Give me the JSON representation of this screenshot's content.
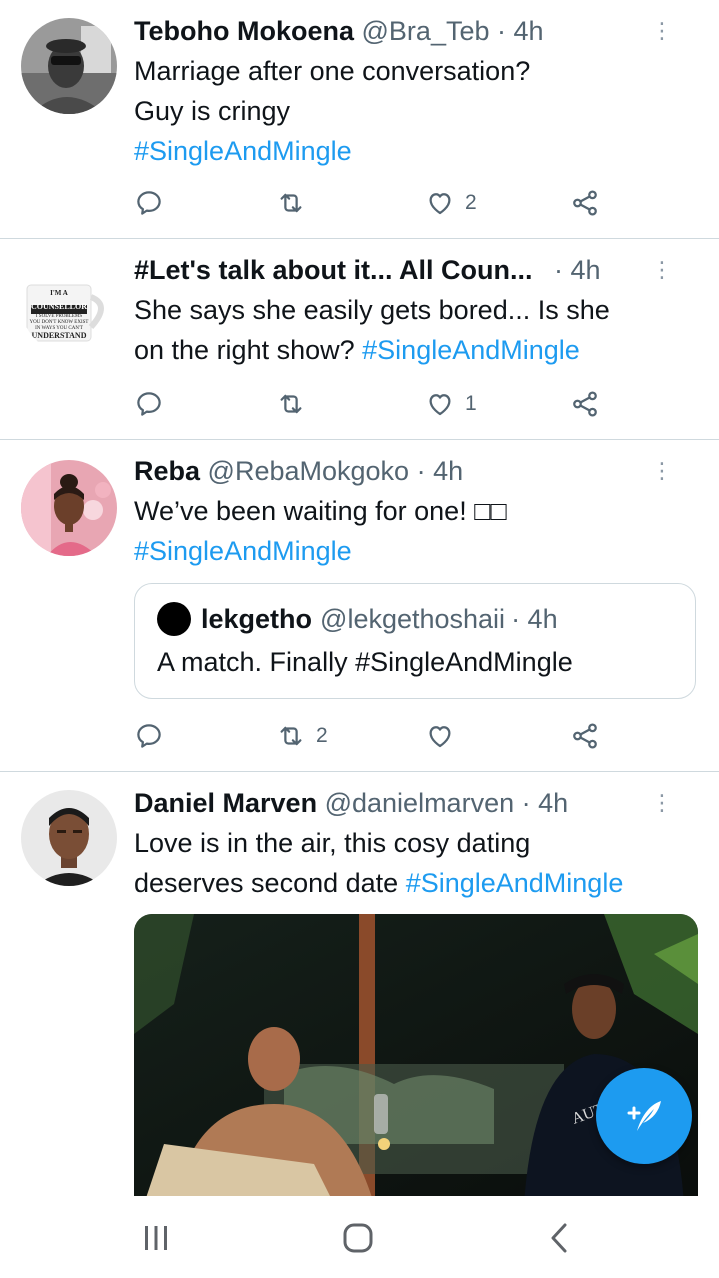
{
  "tweets": [
    {
      "name": "Teboho Mokoena",
      "handle": "@Bra_Teb",
      "time": "· 4h",
      "lines": [
        "Marriage after one conversation?",
        "Guy is cringy"
      ],
      "hashtag": "#SingleAndMingle",
      "reply_count": "",
      "retweet_count": "",
      "like_count": "2"
    },
    {
      "name": "#Let's talk about it... All Coun...",
      "time": "· 4h",
      "text_line1": "She says she easily gets bored... Is she",
      "text_line2_prefix": "on the right show? ",
      "hashtag": "#SingleAndMingle",
      "avatar_text": [
        "I'M A",
        "COUNSELLOR",
        "I SOLVE PROBLEMS",
        "YOU DON'T KNOW EXIST",
        "IN WAYS YOU CAN'T",
        "UNDERSTAND"
      ],
      "like_count": "1"
    },
    {
      "name": "Reba",
      "handle": "@RebaMokgoko",
      "time": "· 4h",
      "text": "We’ve been waiting for one! □□",
      "hashtag": "#SingleAndMingle",
      "retweet_count": "2",
      "quote": {
        "name": "lekgetho",
        "handle": "@lekgethoshaii",
        "time": "· 4h",
        "text": "A match.  Finally #SingleAndMingle"
      }
    },
    {
      "name": "Daniel Marven",
      "handle": "@danielmarven",
      "time": "· 4h",
      "text_line1": "Love is in the air, this cosy dating",
      "text_line2_prefix": "deserves second date ",
      "hashtag": "#SingleAndMingle",
      "media_text": "AUTHENT"
    }
  ],
  "icons": {
    "reply": "reply-icon",
    "retweet": "retweet-icon",
    "like": "like-icon",
    "share": "share-icon",
    "more": "more-vertical-icon",
    "compose": "compose-tweet-icon"
  },
  "colors": {
    "accent": "#1d9bf0",
    "text": "#0f1419",
    "muted": "#536471",
    "divider": "#cfd9de"
  },
  "system_nav": [
    "recents-button",
    "home-button",
    "back-button"
  ]
}
